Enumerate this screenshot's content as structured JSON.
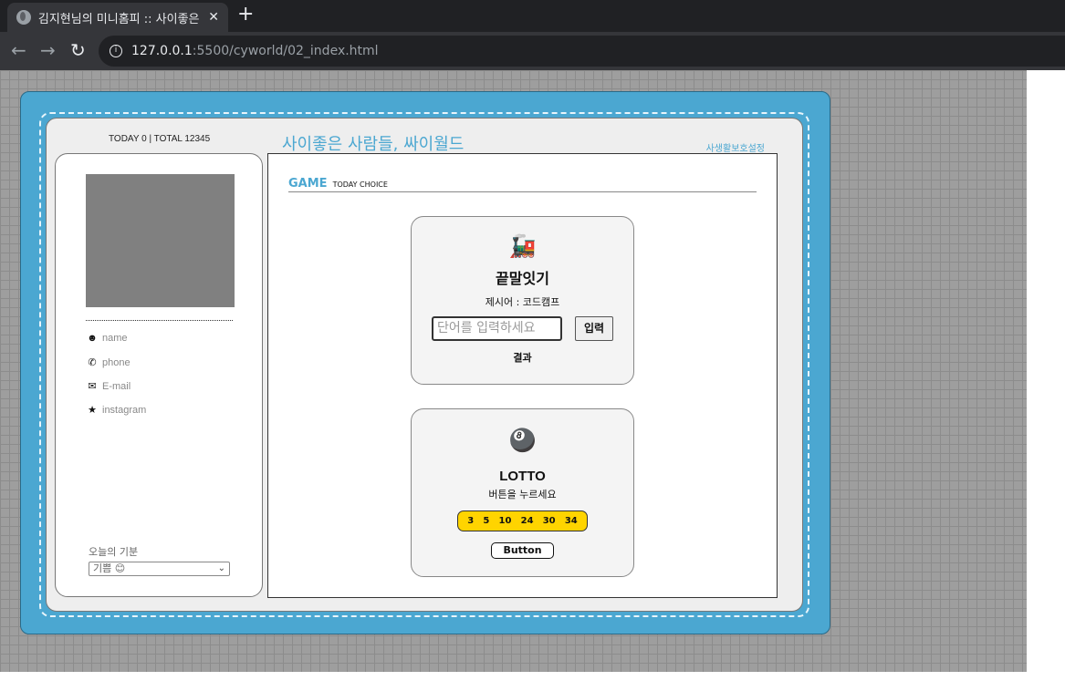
{
  "browser": {
    "tab_title": "김지현님의 미니홈피 :: 사이좋은",
    "close_glyph": "✕",
    "newtab_glyph": "+",
    "back_glyph": "←",
    "forward_glyph": "→",
    "reload_glyph": "↻",
    "url_host": "127.0.0.1",
    "url_path": ":5500/cyworld/02_index.html"
  },
  "counter": "TODAY 0 | TOTAL 12345",
  "site_title": "사이좋은 사람들, 싸이월드",
  "privacy_link": "사생활보호설정",
  "profile": {
    "items": [
      {
        "icon": "☻",
        "label": "name"
      },
      {
        "icon": "✆",
        "label": "phone"
      },
      {
        "icon": "✉",
        "label": "E-mail"
      },
      {
        "icon": "★",
        "label": "instagram"
      }
    ],
    "mood_label": "오늘의 기분",
    "mood_value": "기쁨 😊",
    "mood_chevron": "⌄"
  },
  "game": {
    "title": "GAME",
    "subtitle": "TODAY CHOICE"
  },
  "word_chain": {
    "emoji": "🚂",
    "title": "끝말잇기",
    "suggestion": "제시어 : 코드캠프",
    "input_placeholder": "단어를 입력하세요",
    "button": "입력",
    "result": "결과"
  },
  "lotto": {
    "emoji": "🎱",
    "title": "LOTTO",
    "instruction": "버튼을 누르세요",
    "numbers": [
      "3",
      "5",
      "10",
      "24",
      "30",
      "34"
    ],
    "button": "Button"
  }
}
